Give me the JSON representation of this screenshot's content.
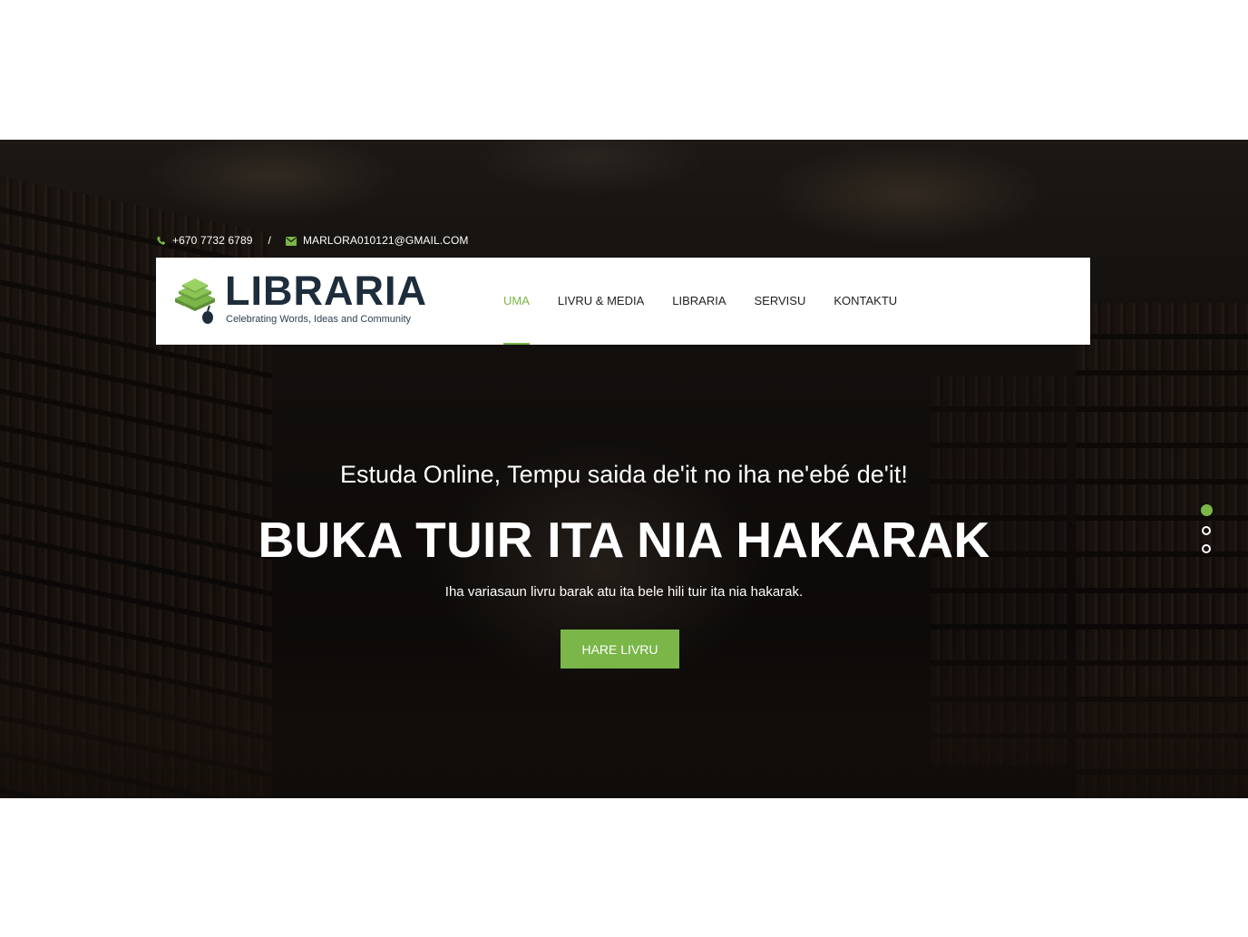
{
  "contact": {
    "phone": "+670 7732 6789",
    "separator": "/",
    "email": "MARLORA010121@GMAIL.COM",
    "phone_icon": "phone-icon",
    "email_icon": "envelope-icon"
  },
  "logo": {
    "title": "LIBRARIA",
    "tagline": "Celebrating Words, Ideas and Community",
    "icon": "stacked-books-logo"
  },
  "nav": {
    "items": [
      {
        "label": "UMA",
        "active": true
      },
      {
        "label": "LIVRU & MEDIA",
        "active": false
      },
      {
        "label": "LIBRARIA",
        "active": false
      },
      {
        "label": "SERVISU",
        "active": false
      },
      {
        "label": "KONTAKTU",
        "active": false
      }
    ]
  },
  "hero": {
    "subtitle": "Estuda Online, Tempu saida de'it no iha ne'ebé de'it!",
    "headline": "BUKA TUIR ITA NIA HAKARAK",
    "description": "Iha variasaun livru barak atu ita bele hili tuir ita nia hakarak.",
    "cta_label": "HARE LIVRU"
  },
  "slider": {
    "total_slides": 3,
    "active_slide": 1
  },
  "colors": {
    "accent": "#7ab648",
    "logo_text": "#1e2d3b"
  }
}
